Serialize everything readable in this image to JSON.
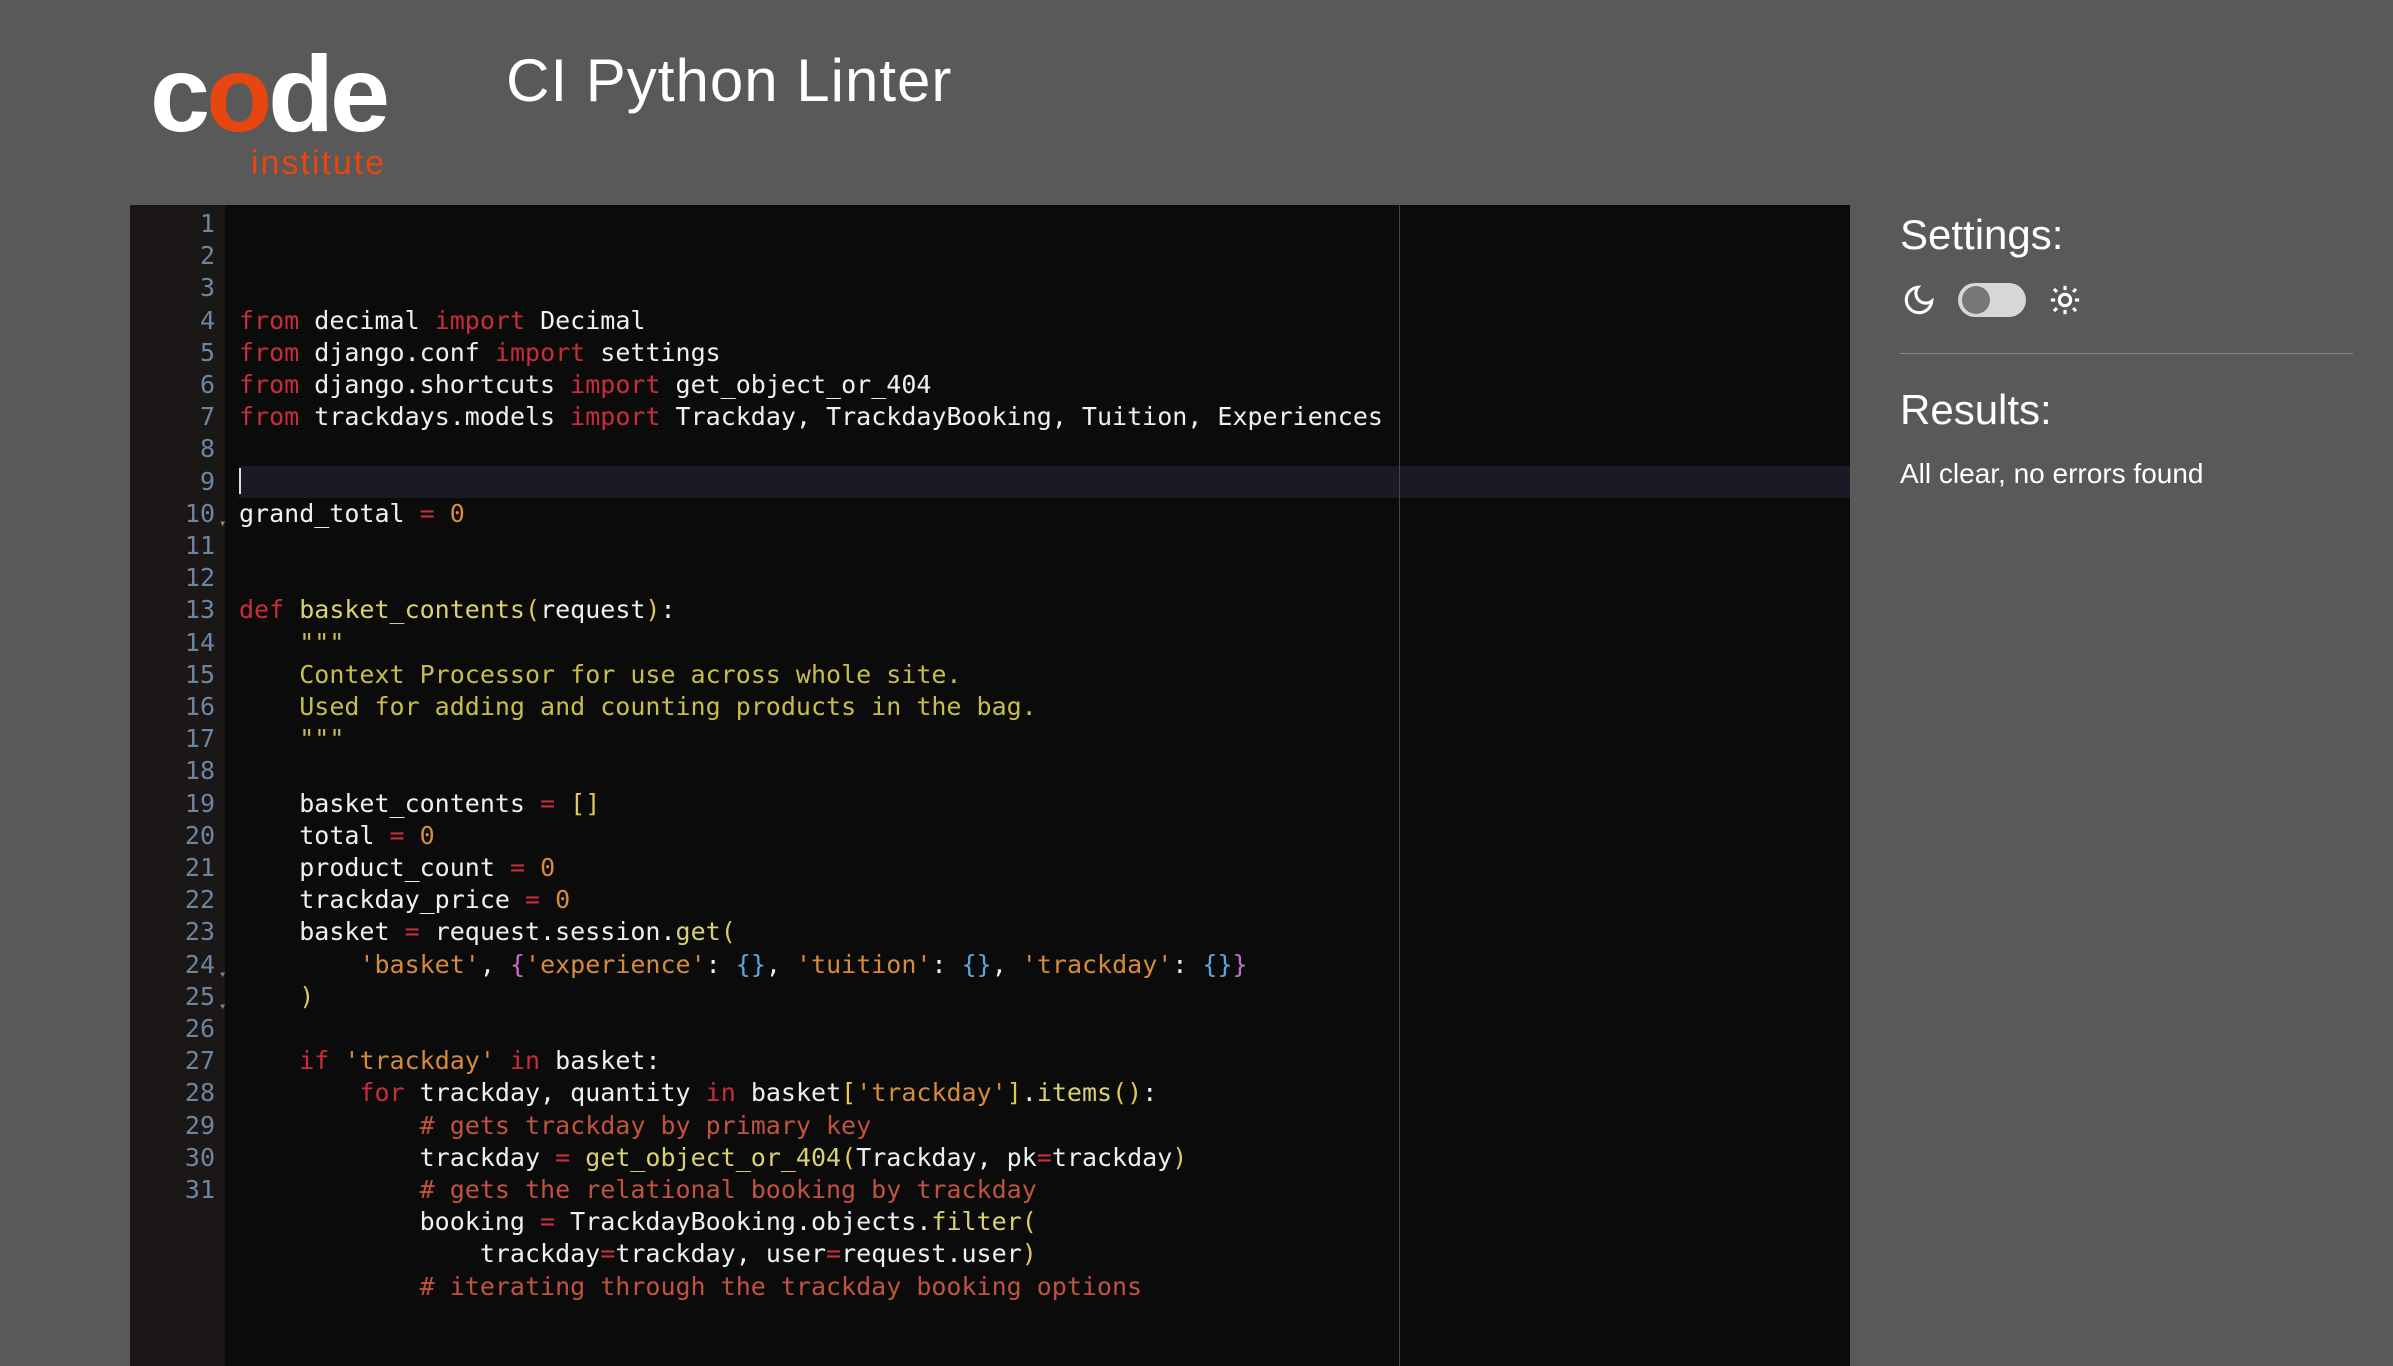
{
  "logo": {
    "text_pre": "c",
    "text_o": "o",
    "text_post": "de",
    "sub": "institute"
  },
  "title": "CI Python Linter",
  "side": {
    "settings_label": "Settings:",
    "results_label": "Results:",
    "results_text": "All clear, no errors found",
    "moon_icon": "moon-icon",
    "sun_icon": "sun-icon",
    "toggle_state": "off"
  },
  "editor": {
    "ruler_col": 80,
    "active_line": 6,
    "fold_lines": [
      10,
      24,
      25
    ],
    "lines": [
      {
        "n": 1,
        "tokens": [
          [
            "kw",
            "from"
          ],
          [
            "ws",
            " "
          ],
          [
            "id",
            "decimal"
          ],
          [
            "ws",
            " "
          ],
          [
            "kw",
            "import"
          ],
          [
            "ws",
            " "
          ],
          [
            "id",
            "Decimal"
          ]
        ]
      },
      {
        "n": 2,
        "tokens": [
          [
            "kw",
            "from"
          ],
          [
            "ws",
            " "
          ],
          [
            "id",
            "django.conf"
          ],
          [
            "ws",
            " "
          ],
          [
            "kw",
            "import"
          ],
          [
            "ws",
            " "
          ],
          [
            "id",
            "settings"
          ]
        ]
      },
      {
        "n": 3,
        "tokens": [
          [
            "kw",
            "from"
          ],
          [
            "ws",
            " "
          ],
          [
            "id",
            "django.shortcuts"
          ],
          [
            "ws",
            " "
          ],
          [
            "kw",
            "import"
          ],
          [
            "ws",
            " "
          ],
          [
            "id",
            "get_object_or_404"
          ]
        ]
      },
      {
        "n": 4,
        "tokens": [
          [
            "kw",
            "from"
          ],
          [
            "ws",
            " "
          ],
          [
            "id",
            "trackdays.models"
          ],
          [
            "ws",
            " "
          ],
          [
            "kw",
            "import"
          ],
          [
            "ws",
            " "
          ],
          [
            "id",
            "Trackday, TrackdayBooking, Tuition, Experiences"
          ]
        ]
      },
      {
        "n": 5,
        "tokens": []
      },
      {
        "n": 6,
        "tokens": [
          [
            "cursor",
            ""
          ]
        ]
      },
      {
        "n": 7,
        "tokens": [
          [
            "id",
            "grand_total "
          ],
          [
            "op",
            "="
          ],
          [
            "ws",
            " "
          ],
          [
            "num",
            "0"
          ]
        ]
      },
      {
        "n": 8,
        "tokens": []
      },
      {
        "n": 9,
        "tokens": []
      },
      {
        "n": 10,
        "tokens": [
          [
            "kw",
            "def"
          ],
          [
            "ws",
            " "
          ],
          [
            "fn",
            "basket_contents"
          ],
          [
            "br",
            "("
          ],
          [
            "id",
            "request"
          ],
          [
            "br",
            ")"
          ],
          [
            "id",
            ":"
          ]
        ]
      },
      {
        "n": 11,
        "tokens": [
          [
            "ws",
            "    "
          ],
          [
            "doc",
            "\"\"\""
          ]
        ]
      },
      {
        "n": 12,
        "tokens": [
          [
            "ws",
            "    "
          ],
          [
            "doc",
            "Context Processor for use across whole site."
          ]
        ]
      },
      {
        "n": 13,
        "tokens": [
          [
            "ws",
            "    "
          ],
          [
            "doc",
            "Used for adding and counting products in the bag."
          ]
        ]
      },
      {
        "n": 14,
        "tokens": [
          [
            "ws",
            "    "
          ],
          [
            "doc",
            "\"\"\""
          ]
        ]
      },
      {
        "n": 15,
        "tokens": []
      },
      {
        "n": 16,
        "tokens": [
          [
            "ws",
            "    "
          ],
          [
            "id",
            "basket_contents "
          ],
          [
            "op",
            "="
          ],
          [
            "ws",
            " "
          ],
          [
            "br",
            "["
          ],
          [
            "br",
            "]"
          ]
        ]
      },
      {
        "n": 17,
        "tokens": [
          [
            "ws",
            "    "
          ],
          [
            "id",
            "total "
          ],
          [
            "op",
            "="
          ],
          [
            "ws",
            " "
          ],
          [
            "num",
            "0"
          ]
        ]
      },
      {
        "n": 18,
        "tokens": [
          [
            "ws",
            "    "
          ],
          [
            "id",
            "product_count "
          ],
          [
            "op",
            "="
          ],
          [
            "ws",
            " "
          ],
          [
            "num",
            "0"
          ]
        ]
      },
      {
        "n": 19,
        "tokens": [
          [
            "ws",
            "    "
          ],
          [
            "id",
            "trackday_price "
          ],
          [
            "op",
            "="
          ],
          [
            "ws",
            " "
          ],
          [
            "num",
            "0"
          ]
        ]
      },
      {
        "n": 20,
        "tokens": [
          [
            "ws",
            "    "
          ],
          [
            "id",
            "basket "
          ],
          [
            "op",
            "="
          ],
          [
            "ws",
            " "
          ],
          [
            "id",
            "request.session."
          ],
          [
            "fn",
            "get"
          ],
          [
            "br",
            "("
          ]
        ]
      },
      {
        "n": 21,
        "tokens": [
          [
            "ws",
            "        "
          ],
          [
            "str",
            "'basket'"
          ],
          [
            "id",
            ", "
          ],
          [
            "br2",
            "{"
          ],
          [
            "str",
            "'experience'"
          ],
          [
            "id",
            ": "
          ],
          [
            "br3",
            "{"
          ],
          [
            "br3",
            "}"
          ],
          [
            "id",
            ", "
          ],
          [
            "str",
            "'tuition'"
          ],
          [
            "id",
            ": "
          ],
          [
            "br3",
            "{"
          ],
          [
            "br3",
            "}"
          ],
          [
            "id",
            ", "
          ],
          [
            "str",
            "'trackday'"
          ],
          [
            "id",
            ": "
          ],
          [
            "br3",
            "{"
          ],
          [
            "br3",
            "}"
          ],
          [
            "br2",
            "}"
          ]
        ]
      },
      {
        "n": 22,
        "tokens": [
          [
            "ws",
            "    "
          ],
          [
            "br",
            ")"
          ]
        ]
      },
      {
        "n": 23,
        "tokens": []
      },
      {
        "n": 24,
        "tokens": [
          [
            "ws",
            "    "
          ],
          [
            "kw",
            "if"
          ],
          [
            "ws",
            " "
          ],
          [
            "str",
            "'trackday'"
          ],
          [
            "ws",
            " "
          ],
          [
            "kw",
            "in"
          ],
          [
            "ws",
            " "
          ],
          [
            "id",
            "basket:"
          ]
        ]
      },
      {
        "n": 25,
        "tokens": [
          [
            "ws",
            "        "
          ],
          [
            "kw",
            "for"
          ],
          [
            "ws",
            " "
          ],
          [
            "id",
            "trackday, quantity"
          ],
          [
            "ws",
            " "
          ],
          [
            "kw",
            "in"
          ],
          [
            "ws",
            " "
          ],
          [
            "id",
            "basket"
          ],
          [
            "br",
            "["
          ],
          [
            "str",
            "'trackday'"
          ],
          [
            "br",
            "]"
          ],
          [
            "id",
            "."
          ],
          [
            "fn",
            "items"
          ],
          [
            "br",
            "("
          ],
          [
            "br",
            ")"
          ],
          [
            "id",
            ":"
          ]
        ]
      },
      {
        "n": 26,
        "tokens": [
          [
            "ws",
            "            "
          ],
          [
            "cmt",
            "# gets trackday by primary key"
          ]
        ]
      },
      {
        "n": 27,
        "tokens": [
          [
            "ws",
            "            "
          ],
          [
            "id",
            "trackday "
          ],
          [
            "op",
            "="
          ],
          [
            "ws",
            " "
          ],
          [
            "fn",
            "get_object_or_404"
          ],
          [
            "br",
            "("
          ],
          [
            "id",
            "Trackday, pk"
          ],
          [
            "op",
            "="
          ],
          [
            "id",
            "trackday"
          ],
          [
            "br",
            ")"
          ]
        ]
      },
      {
        "n": 28,
        "tokens": [
          [
            "ws",
            "            "
          ],
          [
            "cmt",
            "# gets the relational booking by trackday"
          ]
        ]
      },
      {
        "n": 29,
        "tokens": [
          [
            "ws",
            "            "
          ],
          [
            "id",
            "booking "
          ],
          [
            "op",
            "="
          ],
          [
            "ws",
            " "
          ],
          [
            "id",
            "TrackdayBooking.objects."
          ],
          [
            "fn",
            "filter"
          ],
          [
            "br",
            "("
          ]
        ]
      },
      {
        "n": 30,
        "tokens": [
          [
            "ws",
            "                "
          ],
          [
            "id",
            "trackday"
          ],
          [
            "op",
            "="
          ],
          [
            "id",
            "trackday, user"
          ],
          [
            "op",
            "="
          ],
          [
            "id",
            "request.user"
          ],
          [
            "br",
            ")"
          ]
        ]
      },
      {
        "n": 31,
        "tokens": [
          [
            "ws",
            "            "
          ],
          [
            "cmt",
            "# iterating through the trackday booking options"
          ]
        ]
      }
    ]
  }
}
